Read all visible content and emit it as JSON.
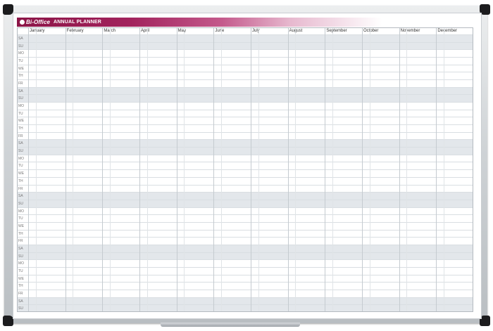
{
  "planner": {
    "brand": "Bi-Office",
    "title": "ANNUAL PLANNER",
    "months": [
      "January",
      "February",
      "March",
      "April",
      "May",
      "June",
      "July",
      "August",
      "September",
      "October",
      "November",
      "December"
    ],
    "day_labels": [
      "SA",
      "SU",
      "MO",
      "TU",
      "WE",
      "TH",
      "FR",
      "SA",
      "SU",
      "MO",
      "TU",
      "WE",
      "TH",
      "FR",
      "SA",
      "SU",
      "MO",
      "TU",
      "WE",
      "TH",
      "FR",
      "SA",
      "SU",
      "MO",
      "TU",
      "WE",
      "TH",
      "FR",
      "SA",
      "SU",
      "MO",
      "TU",
      "WE",
      "TH",
      "FR",
      "SA",
      "SU"
    ],
    "colors": {
      "banner": "#8c1547",
      "weekend_row": "#e3e7eb",
      "frame": "#c8ccd0",
      "corner": "#1c1c1e"
    }
  }
}
